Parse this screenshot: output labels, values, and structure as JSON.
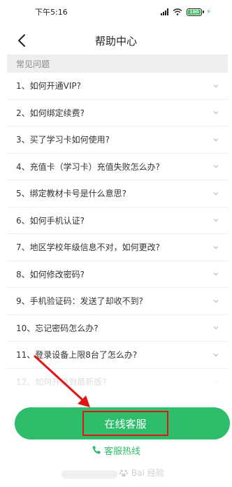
{
  "status": {
    "time": "下午5:16",
    "battery": "100"
  },
  "nav": {
    "title": "帮助中心"
  },
  "section": {
    "title": "常见问题"
  },
  "faq": [
    {
      "text": "1、如何开通VIP?"
    },
    {
      "text": "2、如何绑定续费?"
    },
    {
      "text": "3、买了学习卡如何使用?"
    },
    {
      "text": "4、充值卡（学习卡）充值失败怎么办?"
    },
    {
      "text": "5、绑定教材卡号是什么意思?"
    },
    {
      "text": "6、如何手机认证?"
    },
    {
      "text": "7、地区学校年级信息不对，如何更改?"
    },
    {
      "text": "8、如何修改密码?"
    },
    {
      "text": "9、手机验证码：发送了却收不到?"
    },
    {
      "text": "10、忘记密码怎么办?"
    },
    {
      "text": "11、登录设备上限8台了怎么办?"
    },
    {
      "text": "12、如何升级到最新版?"
    }
  ],
  "actions": {
    "online_label": "在线客服",
    "hotline_label": "客服热线"
  },
  "watermark": {
    "text": "Bai 经验"
  },
  "colors": {
    "accent": "#2ebd6b",
    "highlight": "#e01515"
  }
}
